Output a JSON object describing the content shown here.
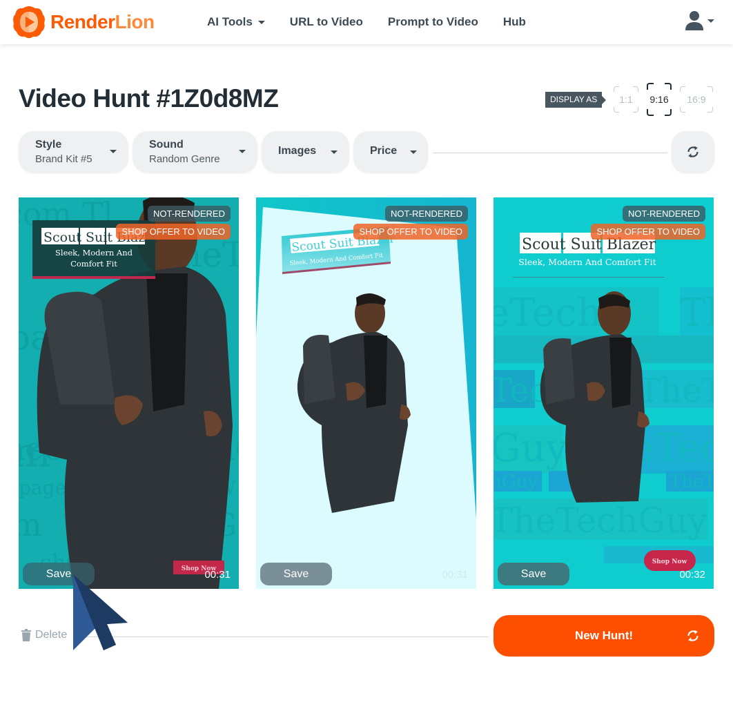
{
  "header": {
    "brand": {
      "part1": "Render",
      "part2": "Lion"
    },
    "nav": [
      {
        "label": "AI Tools",
        "has_dropdown": true
      },
      {
        "label": "URL to Video",
        "has_dropdown": false
      },
      {
        "label": "Prompt to Video",
        "has_dropdown": false
      },
      {
        "label": "Hub",
        "has_dropdown": false
      }
    ],
    "user_icon": "user-icon"
  },
  "page": {
    "title": "Video Hunt #1Z0d8MZ",
    "display_as_label": "DISPLAY AS",
    "ratios": [
      {
        "label": "1:1",
        "active": false
      },
      {
        "label": "9:16",
        "active": true
      },
      {
        "label": "16:9",
        "active": false
      }
    ]
  },
  "filters": [
    {
      "label": "Style",
      "value": "Brand Kit #5"
    },
    {
      "label": "Sound",
      "value": "Random Genre"
    },
    {
      "label": "Images",
      "value": null
    },
    {
      "label": "Price",
      "value": null
    }
  ],
  "refresh_icon": "refresh-icon",
  "videos": [
    {
      "status": "NOT-RENDERED",
      "shop_offer": "SHOP OFFER TO VIDEO",
      "headline": "Scout Suit Blazer",
      "tagline_line1": "Sleek, Modern And",
      "tagline_line2": "Comfort Fit",
      "cta": "Shop Now",
      "save_label": "Save",
      "duration": "00:31",
      "watermark": "TheTechGuy"
    },
    {
      "status": "NOT-RENDERED",
      "shop_offer": "SHOP OFFER TO VIDEO",
      "headline": "Scout Suit Blazer",
      "tagline": "Sleek, Modern And Comfort Fit",
      "save_label": "Save",
      "duration": "00:31"
    },
    {
      "status": "NOT-RENDERED",
      "shop_offer": "SHOP OFFER TO VIDEO",
      "headline": "Scout Suit Blazer",
      "tagline": "Sleek, Modern And Comfort Fit",
      "cta": "Shop Now",
      "save_label": "Save",
      "duration": "00:32",
      "watermark": "TheTechGuy"
    }
  ],
  "footer": {
    "delete_label": "Delete",
    "new_hunt_label": "New Hunt!"
  },
  "colors": {
    "brand_orange": "#fd4f00",
    "teal": "#12b3b5",
    "dark_slate": "#232d35"
  }
}
